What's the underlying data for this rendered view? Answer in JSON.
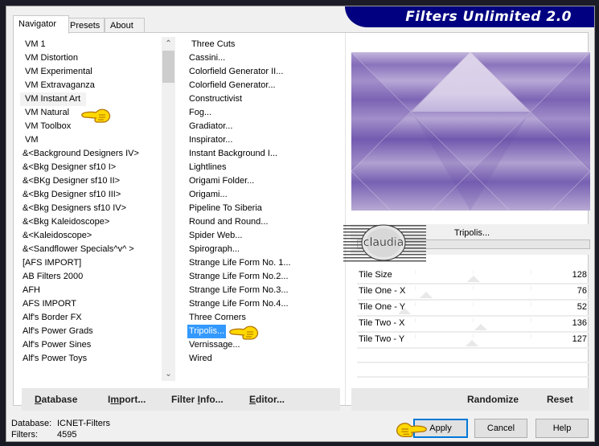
{
  "window": {
    "banner_title": "Filters Unlimited 2.0"
  },
  "tabs": [
    {
      "label": "Navigator",
      "active": true
    },
    {
      "label": "Presets",
      "active": false
    },
    {
      "label": "About",
      "active": false
    }
  ],
  "categories": {
    "items": [
      "VM 1",
      "VM Distortion",
      "VM Experimental",
      "VM Extravaganza",
      "VM Instant Art",
      "VM Natural",
      "VM Toolbox",
      "VM",
      "&<Background Designers IV>",
      "&<Bkg Designer sf10 I>",
      "&<BKg Designer sf10 II>",
      "&<Bkg Designer sf10 III>",
      "&<Bkg Designers sf10 IV>",
      "&<Bkg Kaleidoscope>",
      "&<Kaleidoscope>",
      "&<Sandflower Specials^v^ >",
      "[AFS IMPORT]",
      "AB Filters 2000",
      "AFH",
      "AFS IMPORT",
      "Alf's Border FX",
      "Alf's Power Grads",
      "Alf's Power Sines",
      "Alf's Power Toys"
    ],
    "selected": "VM Instant Art"
  },
  "filters": {
    "items": [
      "Three Cuts",
      "Cassini...",
      "Colorfield Generator II...",
      "Colorfield Generator...",
      "Constructivist",
      "Fog...",
      "Gradiator...",
      "Inspirator...",
      "Instant Background I...",
      "Lightlines",
      "Origami Folder...",
      "Origami...",
      "Pipeline To Siberia",
      "Round and Round...",
      "Spider Web...",
      "Spirograph...",
      "Strange Life Form No. 1...",
      "Strange Life Form No.2...",
      "Strange Life Form No.3...",
      "Strange Life Form No.4...",
      "Three Corners",
      "Tripolis...",
      "Vernissage...",
      "Wired"
    ],
    "selected": "Tripolis..."
  },
  "preview": {
    "filter_name": "Tripolis...",
    "watermark_text": "claudia",
    "colors": {
      "dark": "#6a50a8",
      "mid": "#9a86c8",
      "light": "#ddd4ea"
    }
  },
  "parameters": [
    {
      "label": "Tile Size",
      "value": "128",
      "fraction": 0.502
    },
    {
      "label": "Tile One - X",
      "value": "76",
      "fraction": 0.298
    },
    {
      "label": "Tile One - Y",
      "value": "52",
      "fraction": 0.204
    },
    {
      "label": "Tile Two - X",
      "value": "136",
      "fraction": 0.533
    },
    {
      "label": "Tile Two - Y",
      "value": "127",
      "fraction": 0.498
    }
  ],
  "left_buttons": {
    "database": {
      "pre": "",
      "ul": "D",
      "post": "atabase"
    },
    "import": {
      "pre": "I",
      "ul": "m",
      "post": "port..."
    },
    "filter_info": {
      "pre": "Filter ",
      "ul": "I",
      "post": "nfo..."
    },
    "editor": {
      "pre": "",
      "ul": "E",
      "post": "ditor..."
    }
  },
  "right_buttons": {
    "randomize": "Randomize",
    "reset": "Reset"
  },
  "status": {
    "database_label": "Database:",
    "database_value": "ICNET-Filters",
    "filters_label": "Filters:",
    "filters_value": "4595"
  },
  "dialog_buttons": {
    "apply": "Apply",
    "cancel": "Cancel",
    "help": "Help"
  },
  "scrollbar": {
    "up_icon": "chevron-up-icon",
    "down_icon": "chevron-down-icon"
  },
  "pointer_icons": [
    "hand-pointer-icon"
  ]
}
